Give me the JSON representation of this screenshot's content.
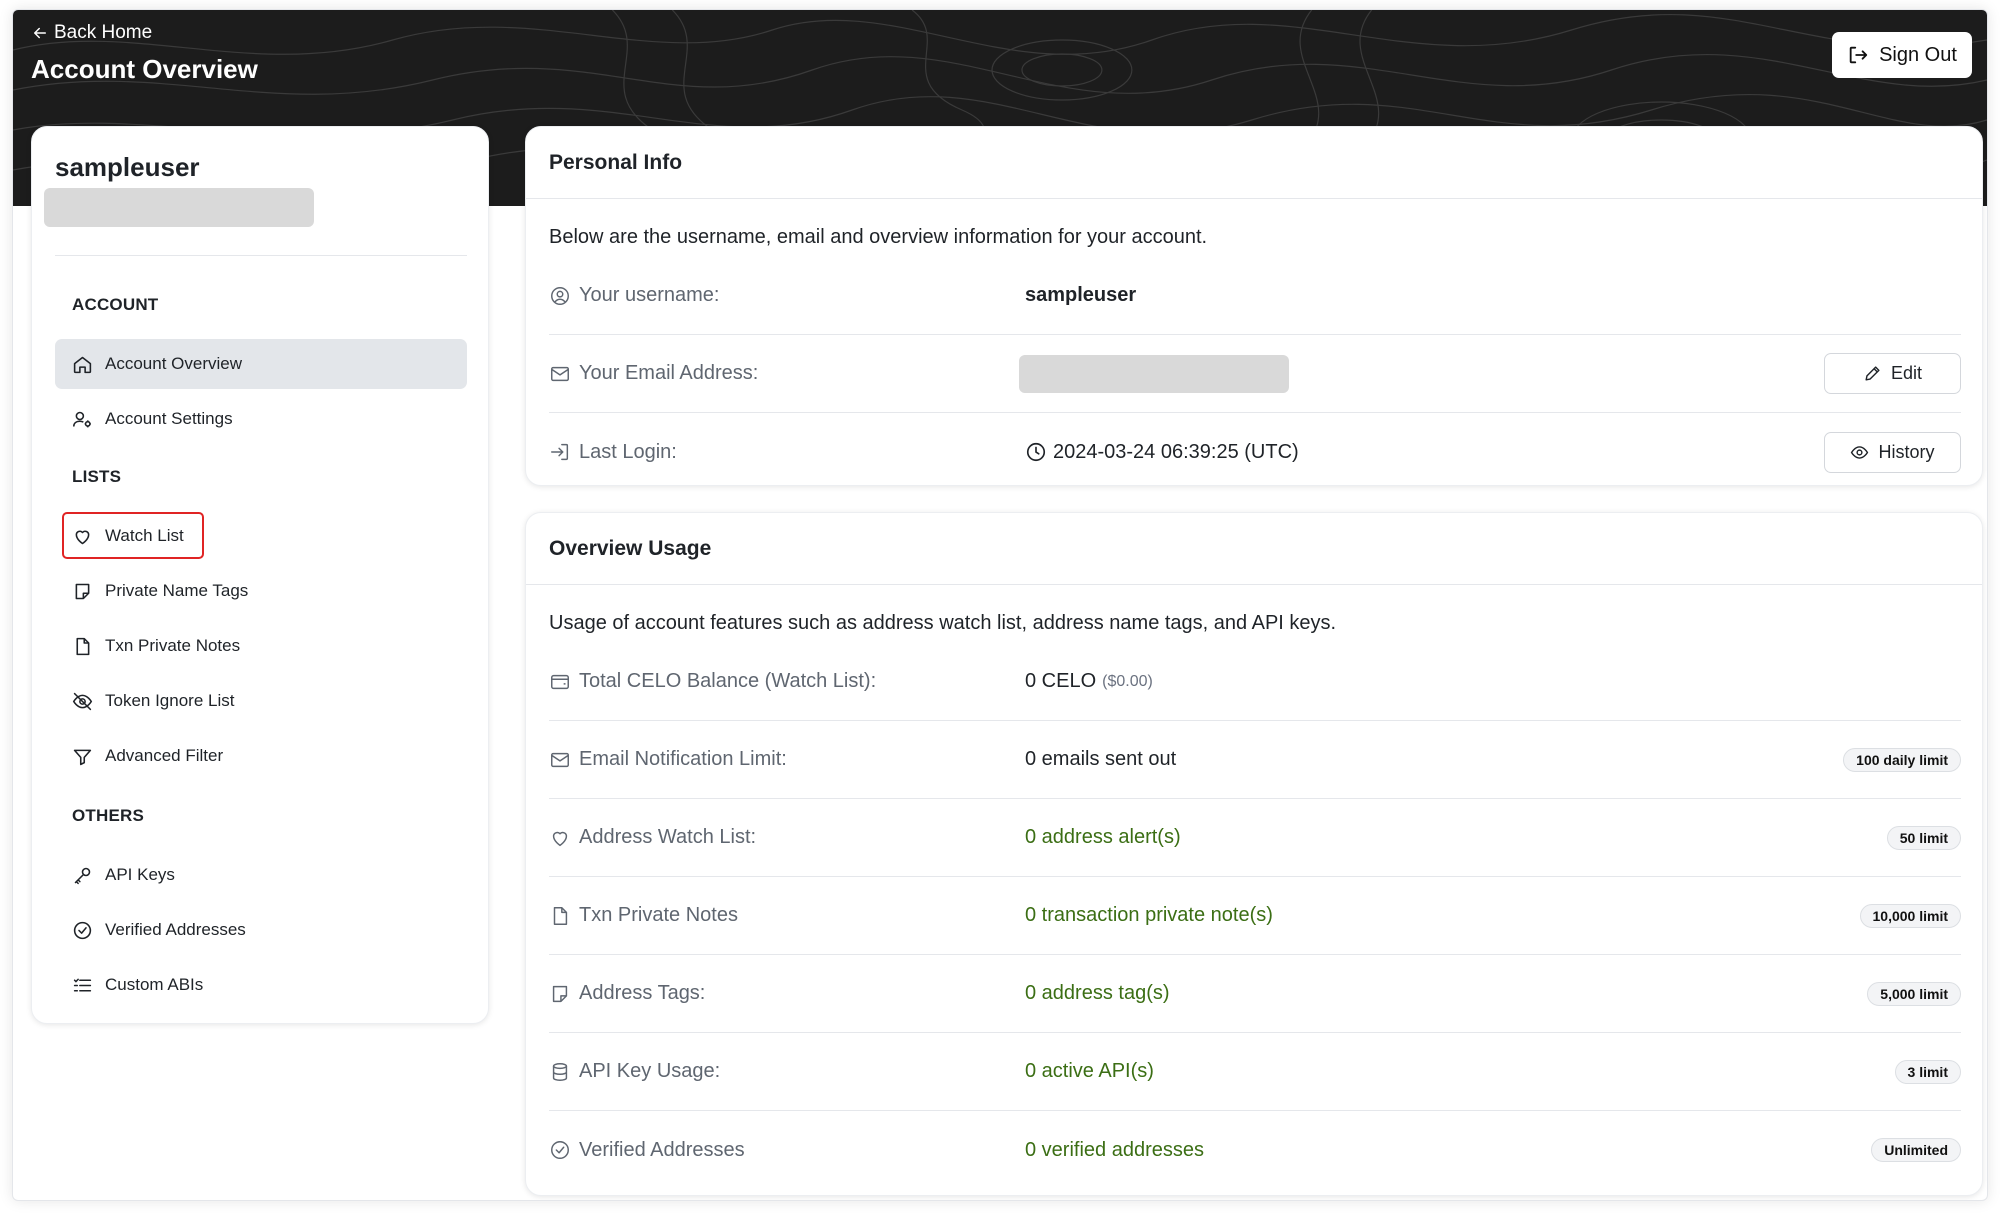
{
  "header": {
    "back_label": "Back Home",
    "title": "Account Overview",
    "sign_out_label": "Sign Out"
  },
  "sidebar": {
    "username": "sampleuser",
    "sections": {
      "account": "ACCOUNT",
      "lists": "LISTS",
      "others": "OTHERS"
    },
    "items": [
      {
        "label": "Account Overview",
        "icon": "home-icon"
      },
      {
        "label": "Account Settings",
        "icon": "user-settings-icon"
      },
      {
        "label": "Watch List",
        "icon": "heart-icon"
      },
      {
        "label": "Private Name Tags",
        "icon": "sticky-note-icon"
      },
      {
        "label": "Txn Private Notes",
        "icon": "file-icon"
      },
      {
        "label": "Token Ignore List",
        "icon": "eye-off-icon"
      },
      {
        "label": "Advanced Filter",
        "icon": "filter-icon"
      },
      {
        "label": "API Keys",
        "icon": "key-icon"
      },
      {
        "label": "Verified Addresses",
        "icon": "check-circle-icon"
      },
      {
        "label": "Custom ABIs",
        "icon": "list-check-icon"
      }
    ]
  },
  "personal_info": {
    "title": "Personal Info",
    "description": "Below are the username, email and overview information for your account.",
    "username_label": "Your username:",
    "username_value": "sampleuser",
    "email_label": "Your Email Address:",
    "edit_label": "Edit",
    "last_login_label": "Last Login:",
    "last_login_value": "2024-03-24 06:39:25 (UTC)",
    "history_label": "History"
  },
  "overview_usage": {
    "title": "Overview Usage",
    "description": "Usage of account features such as address watch list, address name tags, and API keys.",
    "rows": [
      {
        "label": "Total CELO Balance (Watch List):",
        "value": "0 CELO",
        "sub": "($0.00)",
        "icon": "wallet-icon"
      },
      {
        "label": "Email Notification Limit:",
        "value": "0 emails sent out",
        "limit": "100 daily limit",
        "icon": "mail-icon"
      },
      {
        "label": "Address Watch List:",
        "value": "0 address alert(s)",
        "limit": "50 limit",
        "icon": "heart-icon"
      },
      {
        "label": "Txn Private Notes",
        "value": "0 transaction private note(s)",
        "limit": "10,000 limit",
        "icon": "file-icon"
      },
      {
        "label": "Address Tags:",
        "value": "0 address tag(s)",
        "limit": "5,000 limit",
        "icon": "sticky-note-icon"
      },
      {
        "label": "API Key Usage:",
        "value": "0 active API(s)",
        "limit": "3 limit",
        "icon": "database-icon"
      },
      {
        "label": "Verified Addresses",
        "value": "0 verified addresses",
        "limit": "Unlimited",
        "icon": "check-circle-icon"
      }
    ]
  },
  "colors": {
    "hero_bg": "#1c1c1c",
    "active_item_bg": "#e3e6ea",
    "highlight_outline": "#e02424",
    "usage_value_green": "#3b6e14"
  }
}
